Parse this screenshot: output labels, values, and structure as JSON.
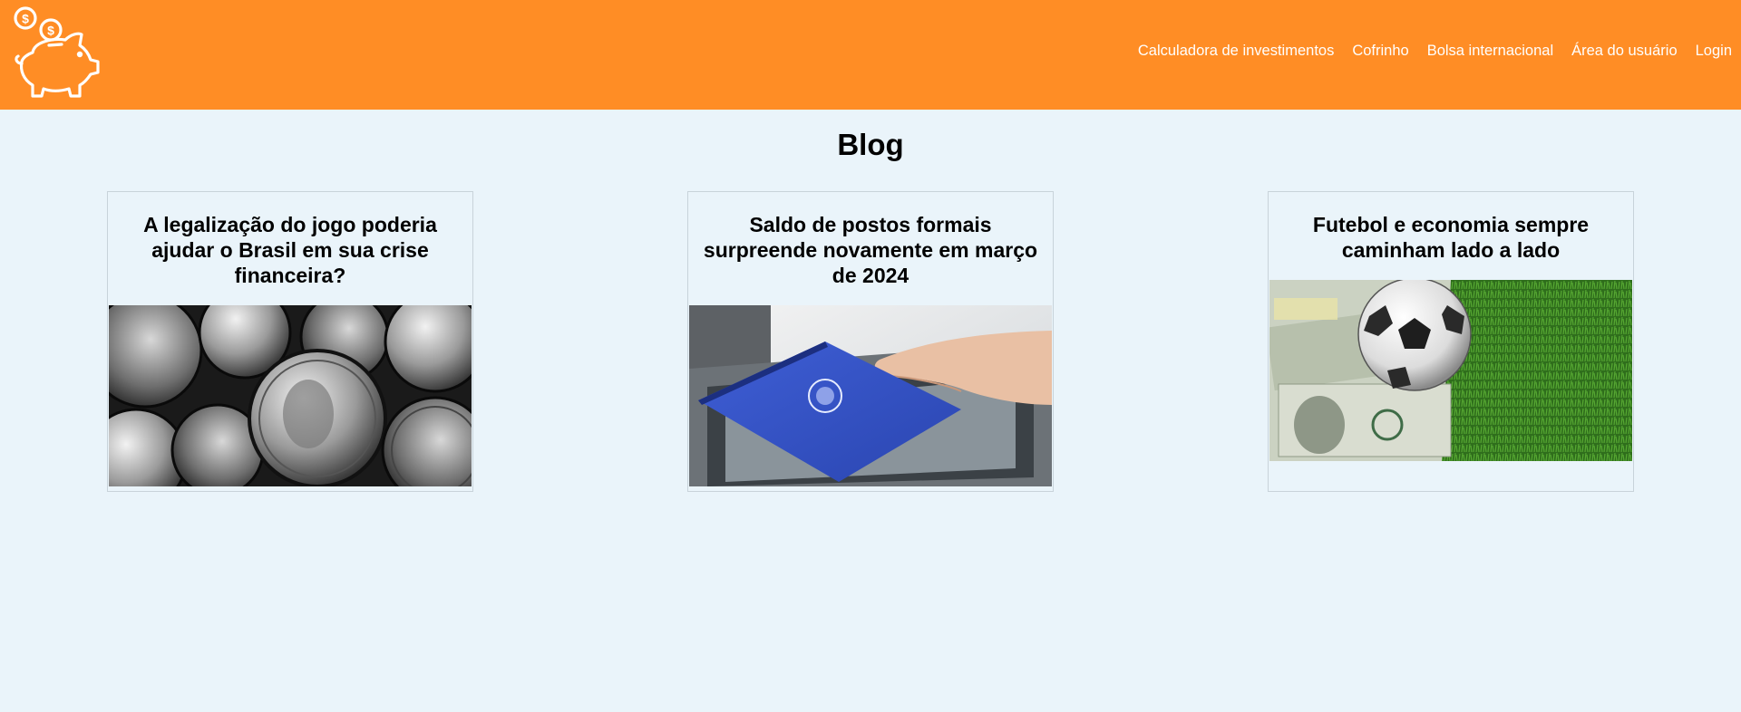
{
  "header": {
    "logo_icon": "piggy-bank-coins-icon",
    "background": "#ff8d25",
    "nav": [
      {
        "label": "Calculadora de investimentos"
      },
      {
        "label": "Cofrinho"
      },
      {
        "label": "Bolsa internacional"
      },
      {
        "label": "Área do usuário"
      },
      {
        "label": "Login"
      }
    ]
  },
  "page": {
    "title": "Blog",
    "background": "#eaf4fa"
  },
  "posts": [
    {
      "title": "A legalização do jogo poderia ajudar o Brasil em sua crise financeira?",
      "image": "coins-photo"
    },
    {
      "title": "Saldo de postos formais surpreende novamente em março de 2024",
      "image": "work-card-photo"
    },
    {
      "title": "Futebol e economia sempre caminham lado a lado",
      "image": "football-money-photo"
    }
  ]
}
